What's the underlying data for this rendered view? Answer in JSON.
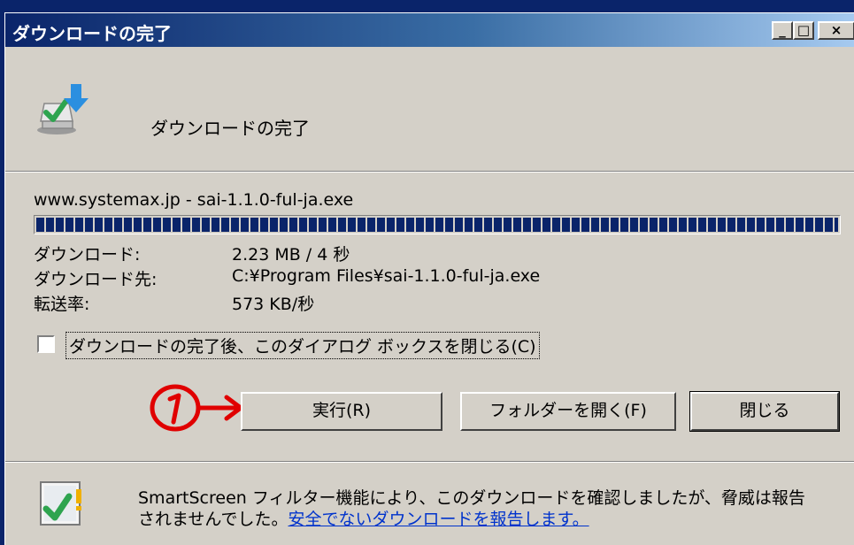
{
  "window": {
    "title": "ダウンロードの完了"
  },
  "titlebar_buttons": {
    "minimize": "_",
    "maximize": "□",
    "close": "×"
  },
  "header": {
    "text": "ダウンロードの完了"
  },
  "download": {
    "source": "www.systemax.jp - sai-1.1.0-ful-ja.exe",
    "progress_percent": 100,
    "rows": [
      {
        "label": "ダウンロード:",
        "value": "2.23 MB / 4 秒"
      },
      {
        "label": "ダウンロード先:",
        "value": "C:¥Program Files¥sai-1.1.0-ful-ja.exe"
      },
      {
        "label": "転送率:",
        "value": "573 KB/秒"
      }
    ]
  },
  "close_on_complete": {
    "label": "ダウンロードの完了後、このダイアログ ボックスを閉じる(C)",
    "checked": false
  },
  "buttons": {
    "run": "実行(R)",
    "open_folder": "フォルダーを開く(F)",
    "close": "閉じる"
  },
  "smartscreen": {
    "line1": "SmartScreen フィルター機能により、このダウンロードを確認しましたが、脅威は報告",
    "line2_prefix": "されませんでした。",
    "link": "安全でないダウンロードを報告します。"
  },
  "annotation": {
    "text": "1",
    "color": "#e00000"
  },
  "colors": {
    "titlebar_start": "#0a246a",
    "titlebar_end": "#a6caf0",
    "face": "#d4d0c8",
    "link": "#0033cc"
  }
}
